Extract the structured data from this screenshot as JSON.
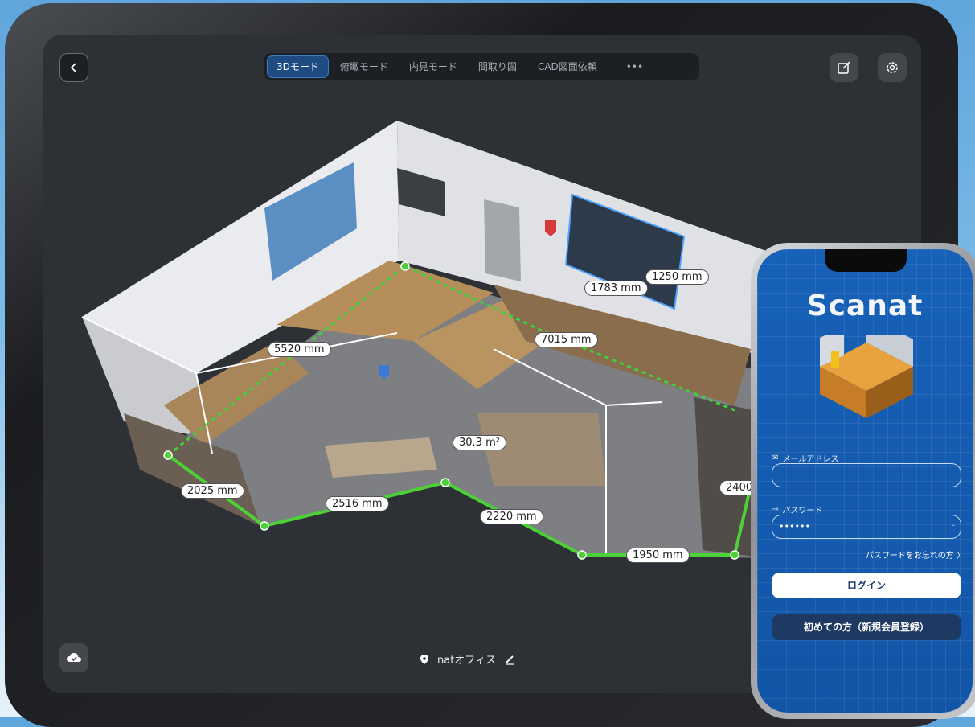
{
  "toolbar": {
    "tabs": [
      {
        "label": "3Dモード",
        "active": true
      },
      {
        "label": "俯瞰モード",
        "active": false
      },
      {
        "label": "内見モード",
        "active": false
      },
      {
        "label": "間取り図",
        "active": false
      },
      {
        "label": "CAD図面依頼",
        "active": false
      },
      {
        "label": "•••",
        "active": false
      }
    ],
    "back_icon": "chevron-left-icon",
    "edit_icon": "edit-square-icon",
    "settings_icon": "gear-icon"
  },
  "measurements": {
    "wall_1250": "1250 mm",
    "wall_1783": "1783 mm",
    "m_5520": "5520 mm",
    "m_7015": "7015 mm",
    "area": "30.3 m²",
    "m_2025": "2025 mm",
    "m_2516": "2516 mm",
    "m_2220": "2220 mm",
    "m_1950": "1950 mm",
    "m_2400": "2400"
  },
  "footer": {
    "location_name": "natオフィス",
    "cloud_icon": "cloud-check-icon",
    "pin_icon": "location-pin-icon",
    "pencil_icon": "pencil-icon"
  },
  "phone": {
    "brand": "Scanat",
    "email_label": "メールアドレス",
    "email_value": "",
    "password_label": "パスワード",
    "password_value": "••••••",
    "forgot_link": "パスワードをお忘れの方 〉",
    "login_button": "ログイン",
    "signup_button": "初めての方（新規会員登録）"
  },
  "colors": {
    "accent": "#1e4c82",
    "measure_line": "#4cd137",
    "phone_bg": "#1761b8"
  }
}
